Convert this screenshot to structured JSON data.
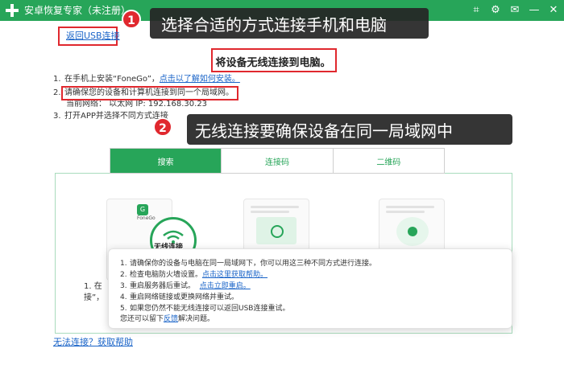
{
  "window": {
    "title": "安卓恢复专家（未注册）",
    "controls": [
      {
        "name": "cart",
        "glyph": "⌗"
      },
      {
        "name": "settings",
        "glyph": "⚙"
      },
      {
        "name": "feedback",
        "glyph": "✉"
      },
      {
        "name": "minimize",
        "glyph": "—"
      },
      {
        "name": "close",
        "glyph": "✕"
      }
    ]
  },
  "back_link": "返回USB连接",
  "heading": "将设备无线连接到电脑。",
  "steps": [
    {
      "num": "1.",
      "text": "在手机上安装“FoneGo”，",
      "link": "点击以了解如何安装。"
    },
    {
      "num": "2.",
      "text": "请确保您的设备和计算机连接到同一个局域网。"
    },
    {
      "num": "",
      "text": "当前网络：  以太网      IP:  192.168.30.23"
    },
    {
      "num": "3.",
      "text": "打开APP并选择不同方式连接"
    }
  ],
  "tabs": [
    {
      "label": "搜索",
      "active": true
    },
    {
      "label": "连接码",
      "active": false
    },
    {
      "label": "二维码",
      "active": false
    }
  ],
  "cards": {
    "app_name": "FoneGo",
    "wifi_label": "无线连接"
  },
  "partial_text": {
    "line1": "1.  在",
    "line2": "接”，"
  },
  "popup": {
    "lines": [
      {
        "num": "1.",
        "text": "请确保你的设备与电脑在同一局域网下，你可以用这三种不同方式进行连接。"
      },
      {
        "num": "2.",
        "text": "检查电脑防火墙设置。",
        "link": "点击这里获取帮助。"
      },
      {
        "num": "3.",
        "text": "重启服务器后重试。",
        "link": "点击立即重启。"
      },
      {
        "num": "4.",
        "text": "重启网络链接或更换网络并重试。"
      },
      {
        "num": "5.",
        "text": "如果您仍然不能无线连接可以返回USB连接重试。"
      },
      {
        "num": "",
        "text": "您还可以留下",
        "link": "反馈",
        "suffix": "解决问题。"
      }
    ]
  },
  "help_link": "无法连接？获取帮助",
  "callouts": [
    {
      "badge": "1",
      "text": "选择合适的方式连接手机和电脑"
    },
    {
      "badge": "2",
      "text": "无线连接要确保设备在同一局域网中"
    }
  ],
  "colors": {
    "brand_green": "#27a559",
    "highlight_red": "#e0282e",
    "link_blue": "#1a64c8"
  }
}
